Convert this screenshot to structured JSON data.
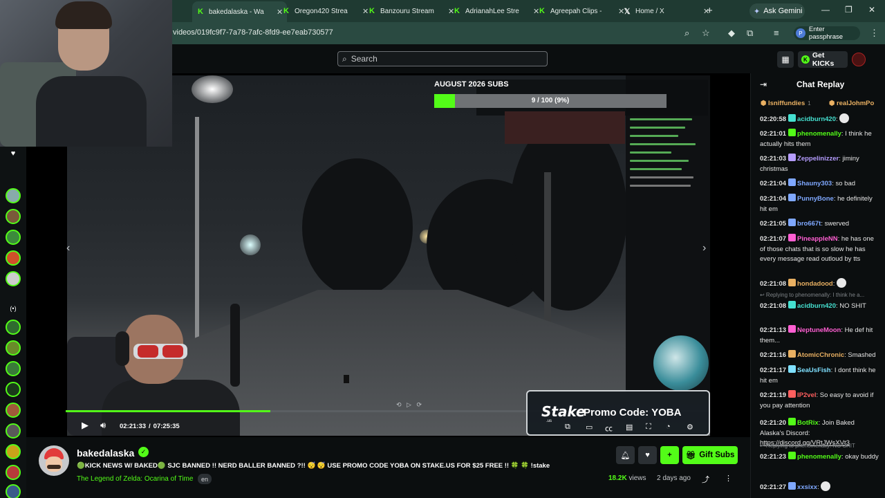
{
  "browser": {
    "tabs": [
      {
        "label": "bakedalaska - Wa",
        "icon": "kick-favicon",
        "active": true
      },
      {
        "label": "Oregon420 Strea",
        "icon": "kick-favicon"
      },
      {
        "label": "Banzouru Stream",
        "icon": "kick-favicon"
      },
      {
        "label": "AdrianahLee Stre",
        "icon": "kick-favicon"
      },
      {
        "label": "Agreepah Clips -",
        "icon": "kick-favicon"
      },
      {
        "label": "Home / X",
        "icon": "x-favicon"
      }
    ],
    "gemini_label": "Ask Gemini",
    "url": "videos/019fc9f7-7a78-7afc-8fd9-ee7eab730577",
    "passphrase_label": "Enter passphrase",
    "passphrase_avatar": "P"
  },
  "header": {
    "search_placeholder": "Search",
    "get_kicks_label": "Get KICKs"
  },
  "video": {
    "subs_goal_title": "AUGUST 2026 SUBS",
    "subs_goal_text": "9 / 100 (9%)",
    "subs_goal_fraction": 0.09,
    "progress_fraction": 0.318,
    "current_time": "02:21:33",
    "duration": "07:25:35",
    "promo_logo": "Stake",
    "promo_logo_sub": ".us",
    "promo_text": "Promo Code: YOBA"
  },
  "channel": {
    "name": "bakedalaska",
    "stream_title": "🟢KICK NEWS W/ BAKED🟢 SJC BANNED !! NERD BALLER BANNED ?!! 😴 😴  USE PROMO CODE YOBA ON STAKE.US FOR $25 FREE !! 🍀 🍀 !stake",
    "category": "The Legend of Zelda: Ocarina of Time",
    "language": "en",
    "views": "18.2K",
    "views_label": "views",
    "age": "2 days ago",
    "gift_label": "Gift Subs"
  },
  "chat": {
    "title": "Chat Replay",
    "pinned": [
      {
        "user": "Isniffundies",
        "count": "1"
      },
      {
        "user": "realJohmPo",
        "count": ""
      }
    ],
    "messages": [
      {
        "ts": "02:20:58",
        "user": "acidburn420",
        "color": "#45e0d0",
        "text": ""
      },
      {
        "ts": "02:21:01",
        "user": "phenomenally",
        "color": "#53fc18",
        "text": "I think he actually hits them"
      },
      {
        "ts": "02:21:03",
        "user": "Zeppelinizzer",
        "color": "#b59cff",
        "text": "jiminy christmas"
      },
      {
        "ts": "02:21:04",
        "user": "Shauny303",
        "color": "#7fa8ff",
        "text": "so bad"
      },
      {
        "ts": "02:21:04",
        "user": "PunnyBone",
        "color": "#7fa8ff",
        "text": "he definitely hit em"
      },
      {
        "ts": "02:21:05",
        "user": "bro667t",
        "color": "#7fa8ff",
        "text": "swerved"
      },
      {
        "ts": "02:21:07",
        "user": "PineappleNN",
        "color": "#ff5fd2",
        "text": "he has one of those chats that is so slow he has every message read outloud by tts"
      },
      {
        "ts": "02:21:08",
        "user": "hondadood",
        "color": "#e9b062",
        "text": ""
      },
      {
        "ts": "02:21:08",
        "user": "acidburn420",
        "color": "#45e0d0",
        "text": "NO SHIT",
        "reply": "Replying to phenomenally: I think he a..."
      },
      {
        "ts": "02:21:13",
        "user": "NeptuneMoon",
        "color": "#ff5fd2",
        "text": "He def hit them..."
      },
      {
        "ts": "02:21:16",
        "user": "AtomicChronic",
        "color": "#e9b062",
        "text": "Smashed"
      },
      {
        "ts": "02:21:17",
        "user": "SeaUsFish",
        "color": "#7fe0ff",
        "text": "I dont think he hit em"
      },
      {
        "ts": "02:21:19",
        "user": "IP2vel",
        "color": "#ff5f5f",
        "text": "So easy to avoid if you pay attention"
      },
      {
        "ts": "02:21:20",
        "user": "BotRix",
        "color": "#53fc18",
        "text": "Join Baked Alaska's Discord: ",
        "link": "https://discord.gg/VRtJWsXVt3"
      },
      {
        "ts": "02:21:23",
        "user": "phenomenally",
        "color": "#53fc18",
        "text": "okay buddy",
        "reply": "Replying to phenomenally: NO SHIT"
      },
      {
        "ts": "02:21:27",
        "user": "xxsixx",
        "color": "#7fa8ff",
        "text": ""
      }
    ]
  },
  "colors": {
    "accent": "#53fc18",
    "browser_tab_bar": "#1f3a32",
    "browser_toolbar": "#2a4a41",
    "page_bg": "#0b0e0f"
  }
}
